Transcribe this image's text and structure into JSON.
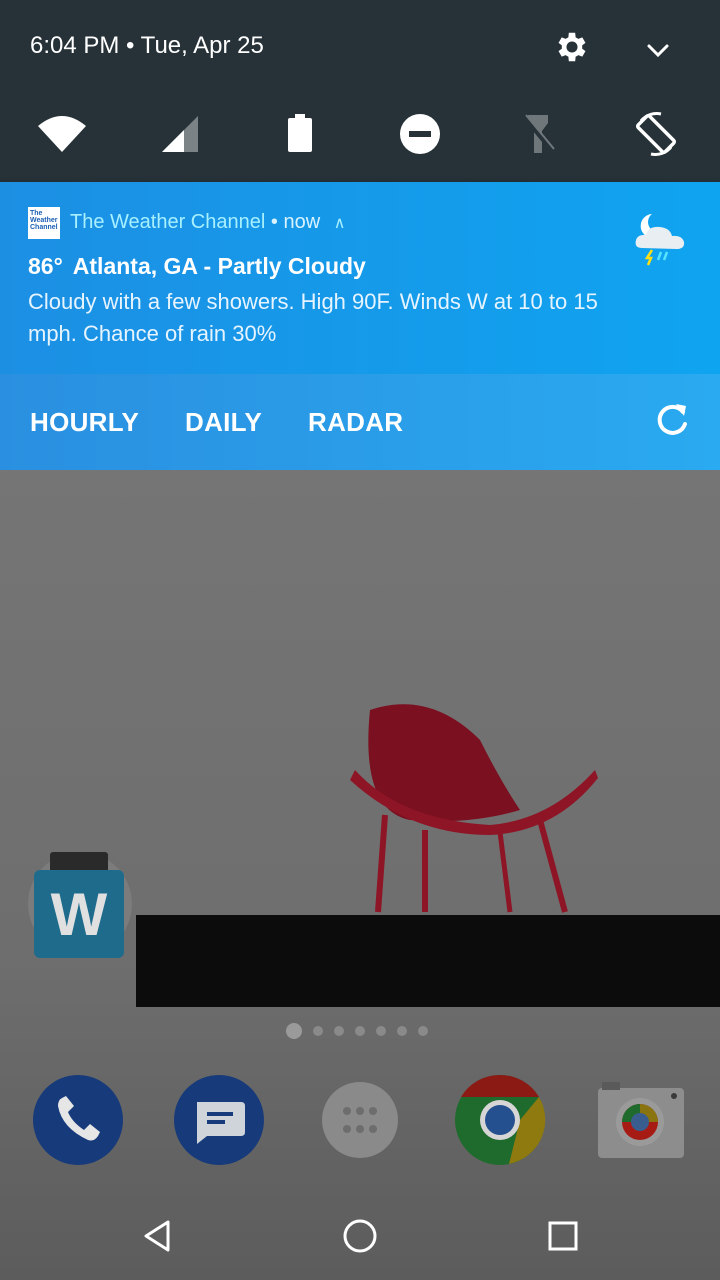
{
  "status": {
    "time_date": "6:04 PM • Tue, Apr 25"
  },
  "quick_tiles": [
    "wifi-icon",
    "signal-icon",
    "battery-icon",
    "do-not-disturb-icon",
    "flashlight-icon",
    "auto-rotate-icon"
  ],
  "notification": {
    "app_name": "The Weather Channel",
    "separator": "•",
    "when": "now",
    "logo_text": [
      "The",
      "Weather",
      "Channel"
    ],
    "temperature": "86°",
    "location_condition": "Atlanta, GA - Partly Cloudy",
    "body": "Cloudy with a few showers. High 90F. Winds W at 10 to 15 mph. Chance of rain 30%",
    "actions": {
      "hourly": "HOURLY",
      "daily": "DAILY",
      "radar": "RADAR"
    }
  },
  "home": {
    "widget_letter": "W",
    "dock": [
      "phone-icon",
      "messages-icon",
      "app-drawer-icon",
      "chrome-icon",
      "camera-icon"
    ],
    "page_count": 7
  },
  "colors": {
    "quick_settings_bg": "#263238",
    "notification_bg": "#1c8fe3",
    "app_name": "#a6f0ff"
  }
}
